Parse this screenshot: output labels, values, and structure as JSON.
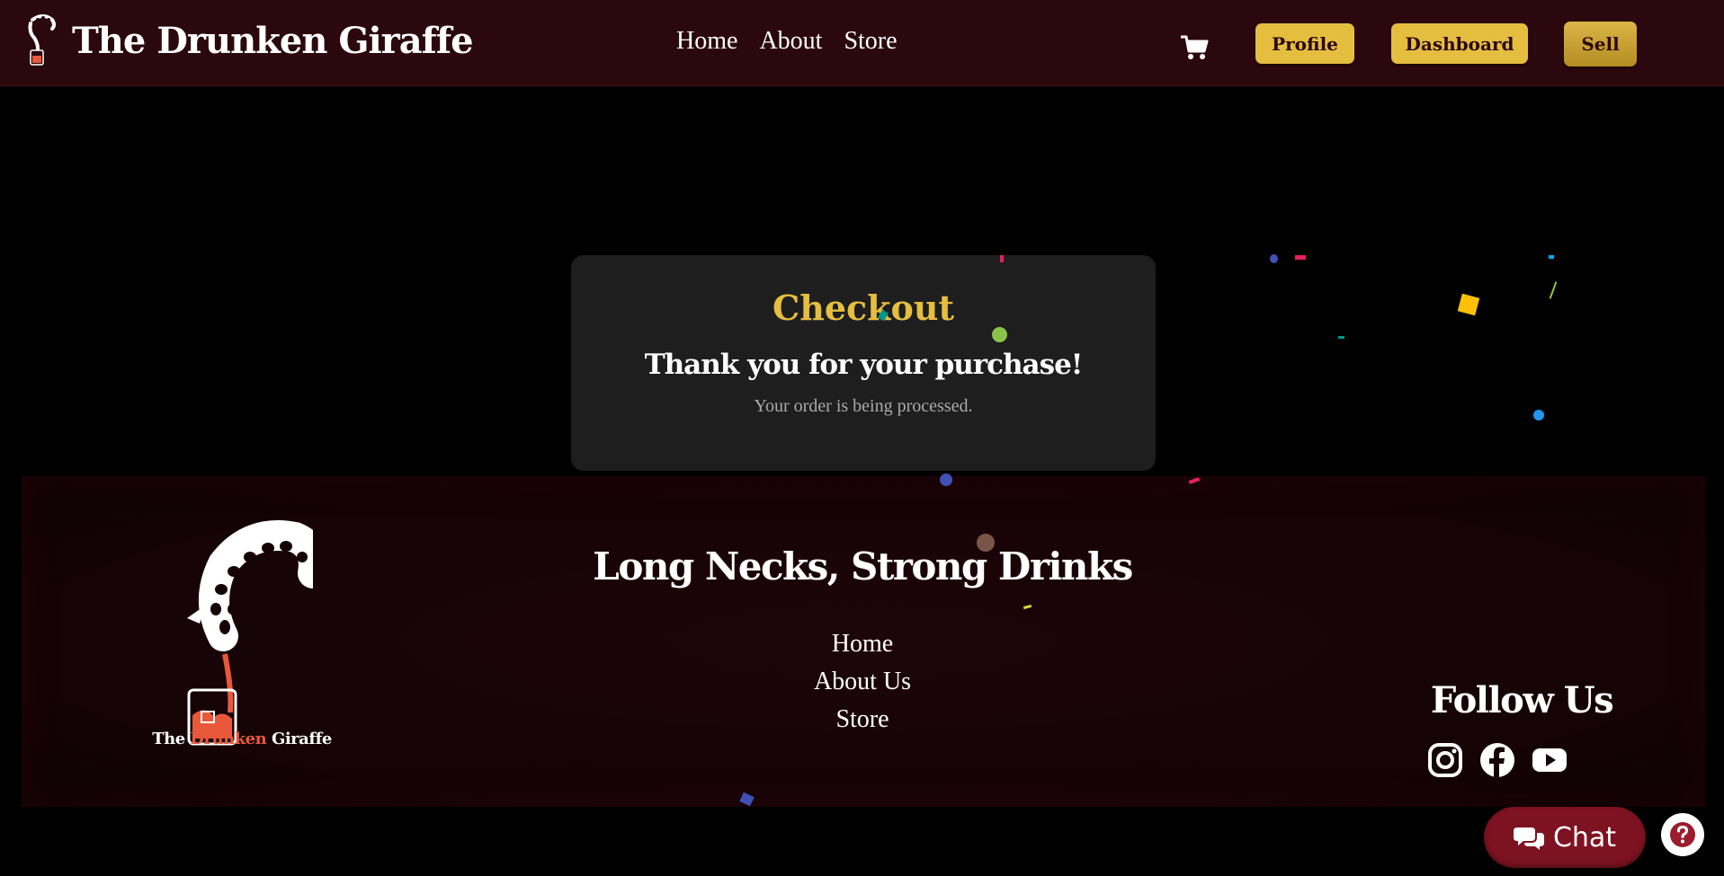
{
  "header": {
    "brand_title": "The Drunken Giraffe",
    "nav": [
      "Home",
      "About",
      "Store"
    ],
    "buttons": {
      "profile": "Profile",
      "dashboard": "Dashboard",
      "sell": "Sell"
    }
  },
  "checkout": {
    "title": "Checkout",
    "thanks": "Thank you for your purchase!",
    "note": "Your order is being processed."
  },
  "footer": {
    "logo_text_pre": "The ",
    "logo_text_accent": "Drunken",
    "logo_text_post": " Giraffe",
    "tagline": "Long Necks, Strong Drinks",
    "links": [
      "Home",
      "About Us",
      "Store"
    ],
    "follow_title": "Follow Us",
    "socials": [
      "instagram-icon",
      "facebook-icon",
      "youtube-icon"
    ]
  },
  "chat": {
    "label": "Chat"
  },
  "colors": {
    "accent_gold": "#e5be40",
    "brand_maroon": "#2b080d",
    "logo_orange": "#e9583a",
    "chat_red": "#7d1220"
  }
}
